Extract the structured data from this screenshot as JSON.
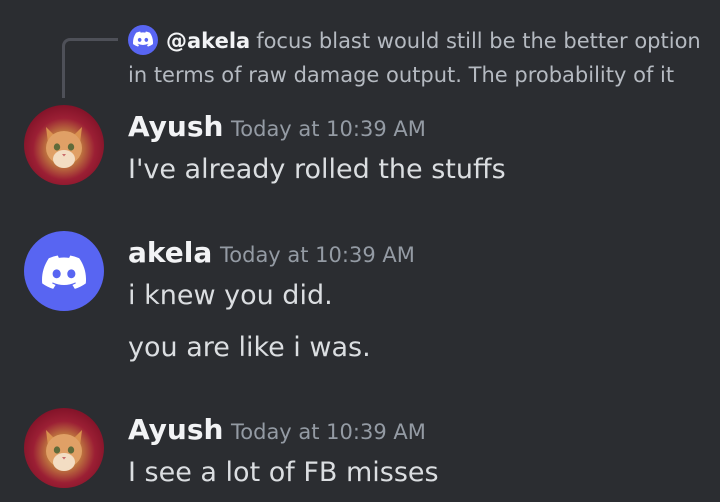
{
  "reply": {
    "username": "@akela",
    "text": "focus blast would still be the better option in terms of raw damage output. The probability of it"
  },
  "messages": [
    {
      "username": "Ayush",
      "timestamp": "Today at 10:39 AM",
      "lines": [
        "I've already rolled the stuffs"
      ]
    },
    {
      "username": "akela",
      "timestamp": "Today at 10:39 AM",
      "lines": [
        "i knew you did.",
        "you are like i was."
      ]
    },
    {
      "username": "Ayush",
      "timestamp": "Today at 10:39 AM",
      "lines": [
        "I see a lot of FB misses"
      ]
    }
  ],
  "colors": {
    "background": "#2b2d31",
    "discord_blurple": "#5865f2",
    "username": "#f2f3f5",
    "timestamp": "#949ba4",
    "message_text": "#dbdee1"
  }
}
